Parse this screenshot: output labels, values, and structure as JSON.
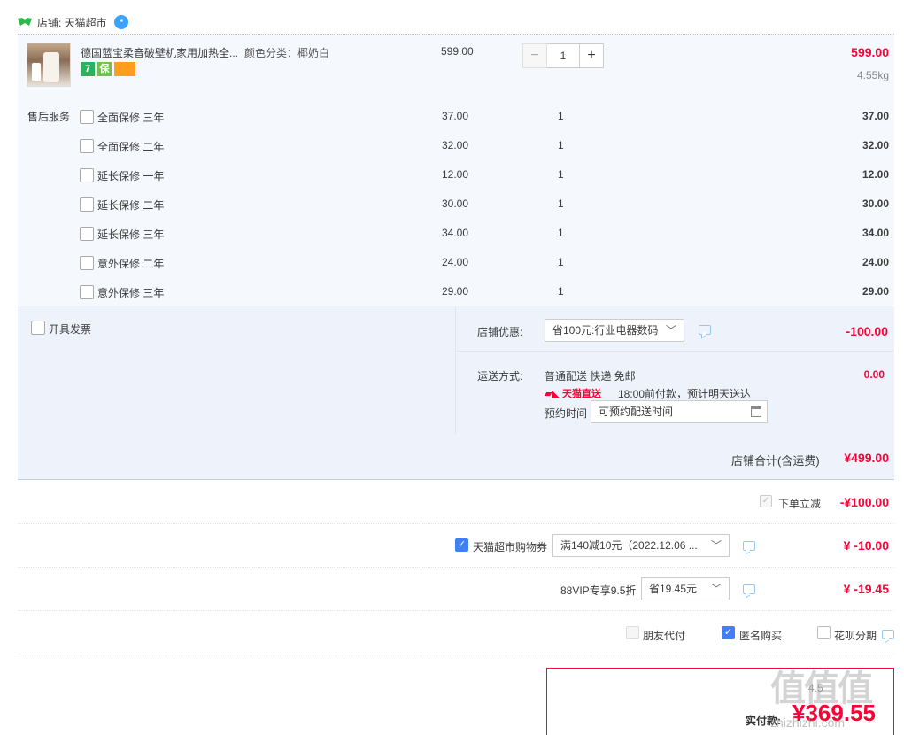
{
  "shop": {
    "label": "店铺: 天猫超市"
  },
  "product": {
    "title": "德国蓝宝柔音破壁机家用加热全...",
    "attr": "颜色分类：椰奶白",
    "badges": [
      "7",
      "保",
      ""
    ],
    "price": "599.00",
    "qty": "1",
    "minus": "−",
    "plus": "+",
    "total": "599.00",
    "weight": "4.55kg"
  },
  "services": {
    "label": "售后服务",
    "items": [
      {
        "name": "全面保修 三年",
        "price": "37.00",
        "qty": "1",
        "total": "37.00"
      },
      {
        "name": "全面保修 二年",
        "price": "32.00",
        "qty": "1",
        "total": "32.00"
      },
      {
        "name": "延长保修 一年",
        "price": "12.00",
        "qty": "1",
        "total": "12.00"
      },
      {
        "name": "延长保修 二年",
        "price": "30.00",
        "qty": "1",
        "total": "30.00"
      },
      {
        "name": "延长保修 三年",
        "price": "34.00",
        "qty": "1",
        "total": "34.00"
      },
      {
        "name": "意外保修 二年",
        "price": "24.00",
        "qty": "1",
        "total": "24.00"
      },
      {
        "name": "意外保修 三年",
        "price": "29.00",
        "qty": "1",
        "total": "29.00"
      }
    ]
  },
  "invoice": {
    "label": "开具发票"
  },
  "shop_coupon": {
    "label": "店铺优惠:",
    "selected": "省100元:行业电器数码",
    "amount": "-100.00"
  },
  "shipping": {
    "label": "运送方式:",
    "method": "普通配送 快递 免邮",
    "tmall_logo": "天猫直送",
    "note": "18:00前付款，预计明天送达",
    "fee": "0.00",
    "reserve_label": "预约时间",
    "reserve_value": "可预约配送时间"
  },
  "shop_total": {
    "label": "店铺合计(含运费)",
    "amount": "¥499.00"
  },
  "instant": {
    "label": "下单立减",
    "amount": "-¥100.00"
  },
  "supermarket_coupon": {
    "label": "天猫超市购物券",
    "selected": "满140减10元（2022.12.06 ...",
    "amount": "¥ -10.00"
  },
  "vip": {
    "label": "88VIP专享9.5折",
    "selected": "省19.45元",
    "amount": "¥ -19.45"
  },
  "options": {
    "friend_pay": "朋友代付",
    "anonymous": "匿名购买",
    "huabei": "花呗分期"
  },
  "pay": {
    "weight": "4.5",
    "label": "实付款:",
    "amount": "¥369.55"
  },
  "watermark": {
    "text": "值值值",
    "sub": "zhizhizhi.com"
  },
  "colors": {
    "accent_red": "#ff0036",
    "check_blue": "#3f7ff7",
    "panel_bg": "#eef3fb"
  }
}
